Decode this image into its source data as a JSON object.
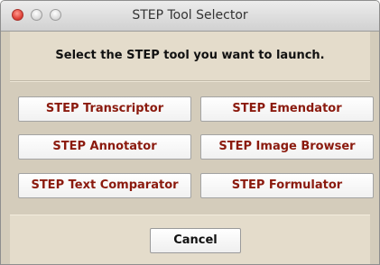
{
  "window": {
    "title": "STEP Tool Selector"
  },
  "prompt": "Select the STEP tool you want to launch.",
  "tools": [
    {
      "label": "STEP Transcriptor"
    },
    {
      "label": "STEP Emendator"
    },
    {
      "label": "STEP Annotator"
    },
    {
      "label": "STEP Image Browser"
    },
    {
      "label": "STEP Text Comparator"
    },
    {
      "label": "STEP Formulator"
    }
  ],
  "footer": {
    "cancel_label": "Cancel"
  },
  "colors": {
    "tool_text": "#8b1a0e",
    "panel_background": "#e4dccb",
    "button_area_background": "#d4ccbb"
  }
}
